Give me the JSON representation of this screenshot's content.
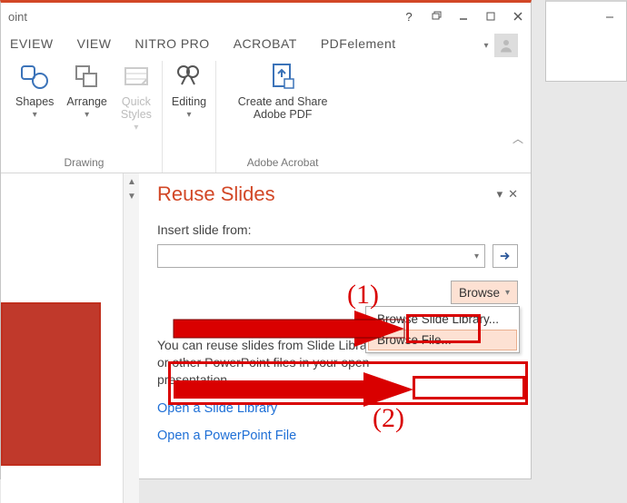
{
  "titlebar": {
    "app_fragment": "oint"
  },
  "ribbon_tabs": [
    "EVIEW",
    "VIEW",
    "NITRO PRO",
    "ACROBAT",
    "PDFelement"
  ],
  "ribbon": {
    "drawing": {
      "label": "Drawing",
      "shapes": "Shapes",
      "arrange": "Arrange",
      "quick_styles": "Quick\nStyles"
    },
    "editing": {
      "btn": "Editing"
    },
    "acrobat": {
      "label": "Adobe Acrobat",
      "btn": "Create and Share\nAdobe PDF"
    }
  },
  "pane": {
    "title": "Reuse Slides",
    "insert_label": "Insert slide from:",
    "browse_label": "Browse",
    "menu": {
      "library": "Browse Slide Library...",
      "file": "Browse File..."
    },
    "info": "You can reuse slides from Slide Libraries or other PowerPoint files in your open presentation.",
    "link_library": "Open a Slide Library",
    "link_file": "Open a PowerPoint File"
  },
  "annotations": {
    "one": "(1)",
    "two": "(2)"
  }
}
